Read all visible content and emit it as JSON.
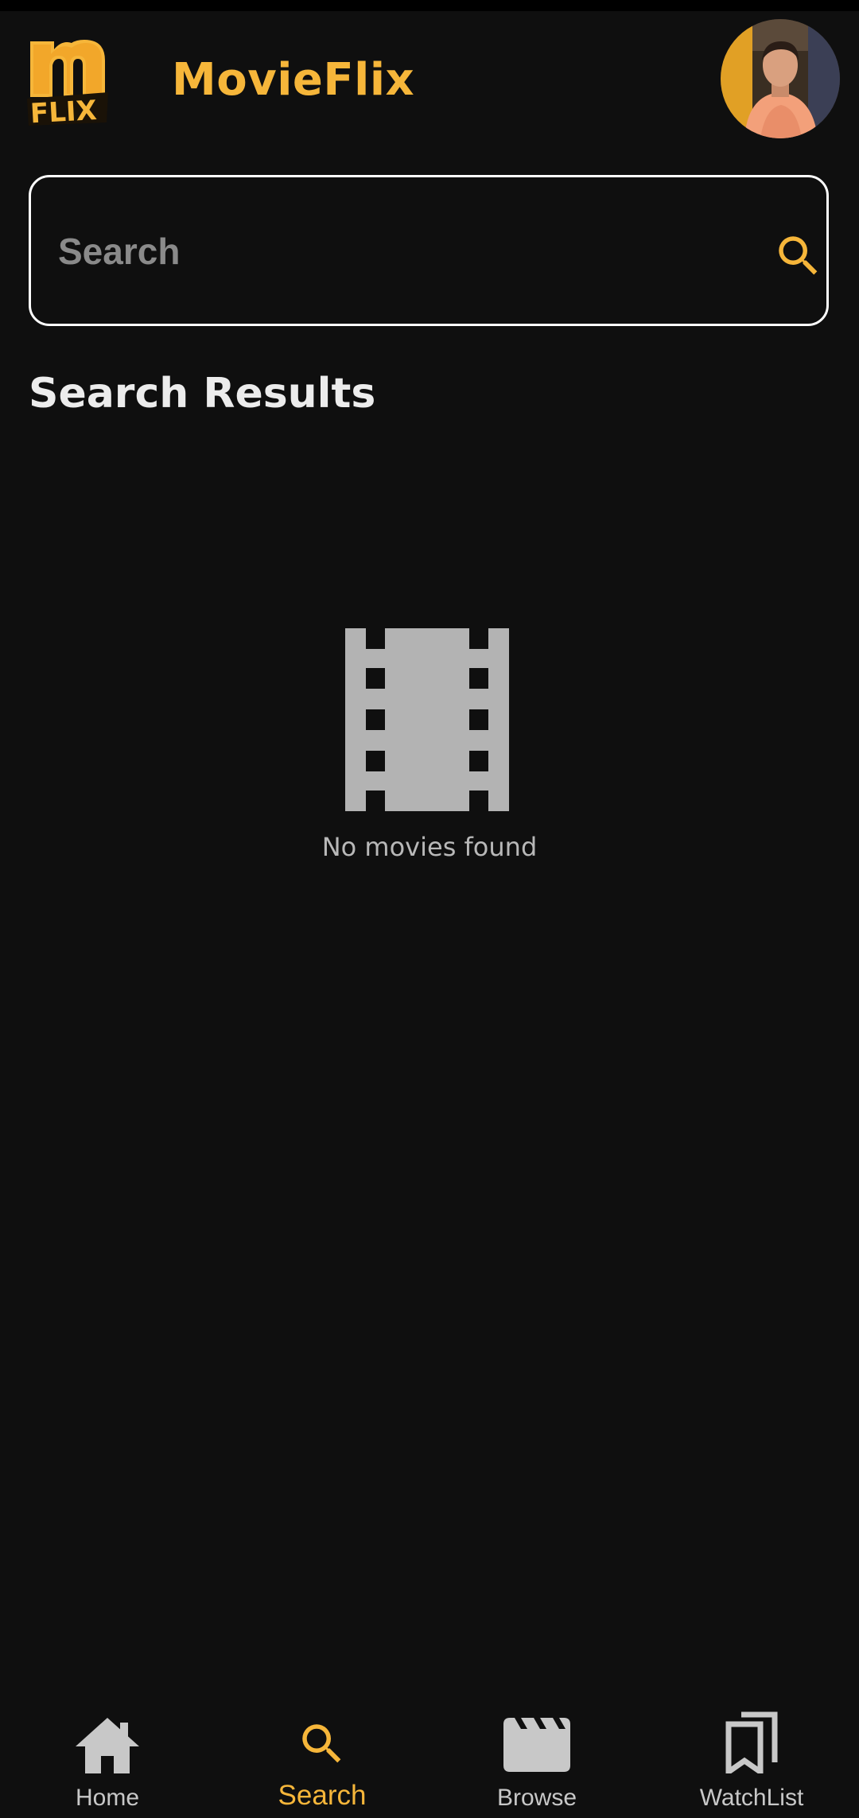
{
  "header": {
    "title": "MovieFlix",
    "logo_text": "m FLIX"
  },
  "search": {
    "placeholder": "Search",
    "value": ""
  },
  "results": {
    "heading": "Search Results",
    "empty_message": "No movies found"
  },
  "bottom_nav": {
    "items": [
      {
        "label": "Home",
        "icon": "home-icon",
        "active": false
      },
      {
        "label": "Search",
        "icon": "search-icon",
        "active": true
      },
      {
        "label": "Browse",
        "icon": "clapperboard-icon",
        "active": false
      },
      {
        "label": "WatchList",
        "icon": "bookmarks-icon",
        "active": false
      }
    ]
  },
  "colors": {
    "background": "#0f0f0f",
    "accent": "#f6b63a",
    "icon_gray": "#b3b3b3",
    "text_muted": "#8a8a8a"
  }
}
